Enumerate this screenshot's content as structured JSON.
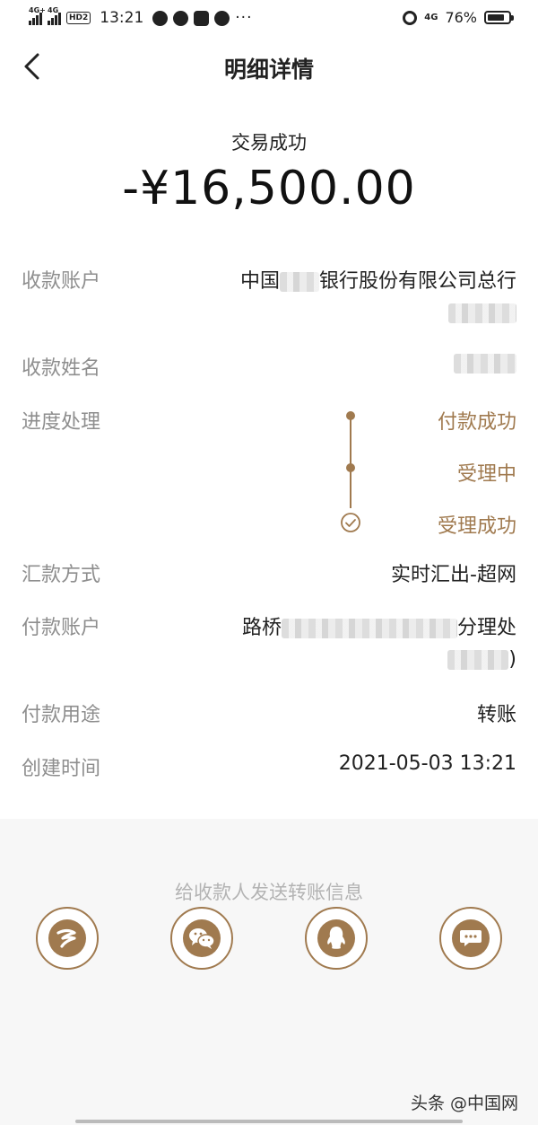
{
  "status_bar": {
    "net1": "4G+",
    "net2": "4G",
    "hd": "HD2",
    "time": "13:21",
    "more": "···",
    "net_right": "4G",
    "battery": "76%"
  },
  "nav": {
    "title": "明细详情"
  },
  "summary": {
    "status": "交易成功",
    "amount": "-¥16,500.00"
  },
  "details": {
    "payee_account_label": "收款账户",
    "payee_account_value_start": "中国",
    "payee_account_value_end": "银行股份有限公司总行",
    "payee_name_label": "收款姓名",
    "progress_label": "进度处理",
    "remit_method_label": "汇款方式",
    "remit_method_value": "实时汇出-超网",
    "payer_account_label": "付款账户",
    "payer_account_value_start": "路桥",
    "payer_account_value_end": "分理处",
    "payer_account_suffix": ")",
    "purpose_label": "付款用途",
    "purpose_value": "转账",
    "created_label": "创建时间",
    "created_value": "2021-05-03 13:21"
  },
  "progress_steps": [
    {
      "label": "付款成功"
    },
    {
      "label": "受理中"
    },
    {
      "label": "受理成功"
    }
  ],
  "share": {
    "title": "给收款人发送转账信息",
    "buttons": [
      {
        "icon": "bank-app-icon"
      },
      {
        "icon": "wechat-icon"
      },
      {
        "icon": "qq-icon"
      },
      {
        "icon": "sms-icon"
      }
    ]
  },
  "watermark": "头条 @中国网",
  "colors": {
    "accent": "#a07a4f",
    "label_gray": "#8e8e8e",
    "share_bg": "#f7f7f7"
  }
}
